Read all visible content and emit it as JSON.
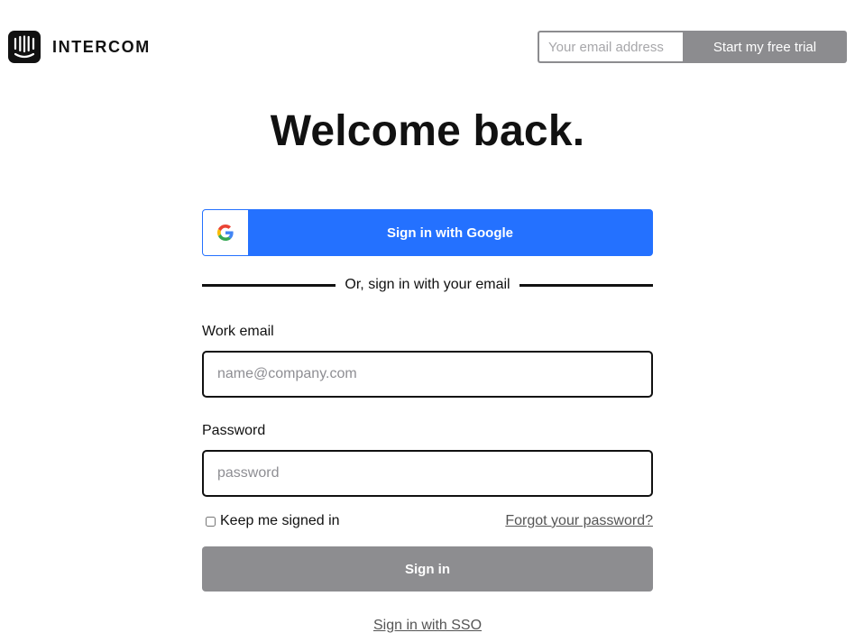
{
  "header": {
    "brand_name": "INTERCOM",
    "logo_icon": "intercom-logo-icon",
    "trial_email_placeholder": "Your email address",
    "trial_button_label": "Start my free trial"
  },
  "main": {
    "title": "Welcome back.",
    "google_button_label": "Sign in with Google",
    "google_icon": "google-g-icon",
    "divider_text": "Or, sign in with your email",
    "email_label": "Work email",
    "email_placeholder": "name@company.com",
    "password_label": "Password",
    "password_placeholder": "password",
    "remember_label": "Keep me signed in",
    "forgot_link": "Forgot your password?",
    "signin_button_label": "Sign in",
    "sso_link": "Sign in with SSO"
  },
  "colors": {
    "google_blue": "#2471ff",
    "disabled_gray": "#8d8d90",
    "text": "#111111"
  }
}
